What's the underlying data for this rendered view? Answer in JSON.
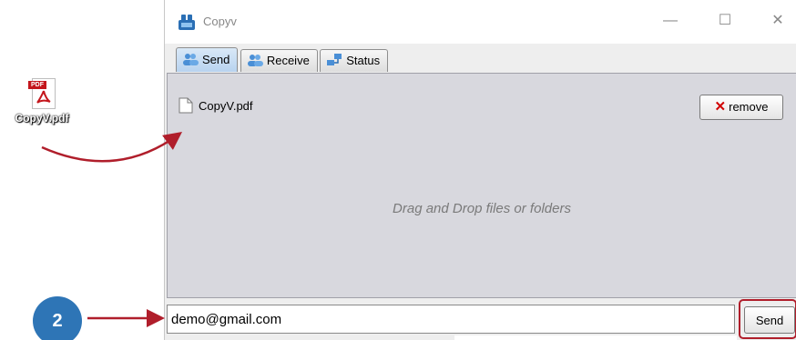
{
  "desktop": {
    "file_label": "CopyV.pdf",
    "file_icon": "pdf-file-icon",
    "pdf_badge_text": "PDF"
  },
  "window": {
    "title": "Copyv",
    "app_icon": "copyv-app-icon",
    "controls": {
      "minimize": "—",
      "maximize": "☐",
      "close": "✕"
    }
  },
  "tabs": [
    {
      "label": "Send",
      "icon": "send-users-icon",
      "active": true
    },
    {
      "label": "Receive",
      "icon": "receive-users-icon",
      "active": false
    },
    {
      "label": "Status",
      "icon": "status-network-icon",
      "active": false
    }
  ],
  "drop_panel": {
    "files": [
      {
        "name": "CopyV.pdf",
        "icon": "document-icon"
      }
    ],
    "remove_label": "remove",
    "hint": "Drag and Drop files or folders"
  },
  "email": {
    "value": "demo@gmail.com"
  },
  "send_label": "Send",
  "step_badge": "2",
  "colors": {
    "annotation_red": "#b01e2b",
    "badge_blue": "#2e75b6",
    "active_tab": "#b8d3ef",
    "panel_bg": "#d8d8de"
  }
}
